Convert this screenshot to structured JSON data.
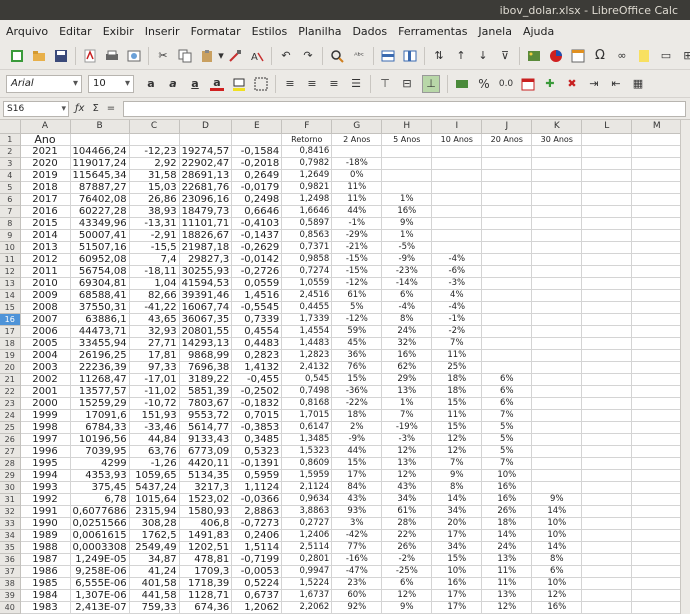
{
  "window": {
    "title": "ibov_dolar.xlsx - LibreOffice Calc"
  },
  "menu": [
    "Arquivo",
    "Editar",
    "Exibir",
    "Inserir",
    "Formatar",
    "Estilos",
    "Planilha",
    "Dados",
    "Ferramentas",
    "Janela",
    "Ajuda"
  ],
  "formatting": {
    "font_name": "Arial",
    "font_size": "10"
  },
  "formula_bar": {
    "cell_ref": "S16",
    "fx": "ƒx",
    "sum": "Σ",
    "equals": "=",
    "content": ""
  },
  "selected_row": 16,
  "columns": [
    "A",
    "B",
    "C",
    "D",
    "E",
    "F",
    "G",
    "H",
    "I",
    "J",
    "K",
    "L",
    "M"
  ],
  "rows": [
    [
      "Ano",
      "",
      "",
      "",
      "",
      "Retorno",
      "2 Anos",
      "5 Anos",
      "10 Anos",
      "20 Anos",
      "30 Anos",
      "",
      ""
    ],
    [
      "2021",
      "104466,24",
      "-12,23",
      "19274,57",
      "-0,1584",
      "0,8416",
      "",
      "",
      "",
      "",
      "",
      "",
      ""
    ],
    [
      "2020",
      "119017,24",
      "2,92",
      "22902,47",
      "-0,2018",
      "0,7982",
      "-18%",
      "",
      "",
      "",
      "",
      "",
      ""
    ],
    [
      "2019",
      "115645,34",
      "31,58",
      "28691,13",
      "0,2649",
      "1,2649",
      "0%",
      "",
      "",
      "",
      "",
      "",
      ""
    ],
    [
      "2018",
      "87887,27",
      "15,03",
      "22681,76",
      "-0,0179",
      "0,9821",
      "11%",
      "",
      "",
      "",
      "",
      "",
      ""
    ],
    [
      "2017",
      "76402,08",
      "26,86",
      "23096,16",
      "0,2498",
      "1,2498",
      "11%",
      "1%",
      "",
      "",
      "",
      "",
      ""
    ],
    [
      "2016",
      "60227,28",
      "38,93",
      "18479,73",
      "0,6646",
      "1,6646",
      "44%",
      "16%",
      "",
      "",
      "",
      "",
      ""
    ],
    [
      "2015",
      "43349,96",
      "-13,31",
      "11101,71",
      "-0,4103",
      "0,5897",
      "-1%",
      "9%",
      "",
      "",
      "",
      "",
      ""
    ],
    [
      "2014",
      "50007,41",
      "-2,91",
      "18826,67",
      "-0,1437",
      "0,8563",
      "-29%",
      "1%",
      "",
      "",
      "",
      "",
      ""
    ],
    [
      "2013",
      "51507,16",
      "-15,5",
      "21987,18",
      "-0,2629",
      "0,7371",
      "-21%",
      "-5%",
      "",
      "",
      "",
      "",
      ""
    ],
    [
      "2012",
      "60952,08",
      "7,4",
      "29827,3",
      "-0,0142",
      "0,9858",
      "-15%",
      "-9%",
      "-4%",
      "",
      "",
      "",
      ""
    ],
    [
      "2011",
      "56754,08",
      "-18,11",
      "30255,93",
      "-0,2726",
      "0,7274",
      "-15%",
      "-23%",
      "-6%",
      "",
      "",
      "",
      ""
    ],
    [
      "2010",
      "69304,81",
      "1,04",
      "41594,53",
      "0,0559",
      "1,0559",
      "-12%",
      "-14%",
      "-3%",
      "",
      "",
      "",
      ""
    ],
    [
      "2009",
      "68588,41",
      "82,66",
      "39391,46",
      "1,4516",
      "2,4516",
      "61%",
      "6%",
      "4%",
      "",
      "",
      "",
      ""
    ],
    [
      "2008",
      "37550,31",
      "-41,22",
      "16067,74",
      "-0,5545",
      "0,4455",
      "5%",
      "-4%",
      "-4%",
      "",
      "",
      "",
      ""
    ],
    [
      "2007",
      "63886,1",
      "43,65",
      "36067,35",
      "0,7339",
      "1,7339",
      "-12%",
      "8%",
      "-1%",
      "",
      "",
      "",
      ""
    ],
    [
      "2006",
      "44473,71",
      "32,93",
      "20801,55",
      "0,4554",
      "1,4554",
      "59%",
      "24%",
      "-2%",
      "",
      "",
      "",
      ""
    ],
    [
      "2005",
      "33455,94",
      "27,71",
      "14293,13",
      "0,4483",
      "1,4483",
      "45%",
      "32%",
      "7%",
      "",
      "",
      "",
      ""
    ],
    [
      "2004",
      "26196,25",
      "17,81",
      "9868,99",
      "0,2823",
      "1,2823",
      "36%",
      "16%",
      "11%",
      "",
      "",
      "",
      ""
    ],
    [
      "2003",
      "22236,39",
      "97,33",
      "7696,38",
      "1,4132",
      "2,4132",
      "76%",
      "62%",
      "25%",
      "",
      "",
      "",
      ""
    ],
    [
      "2002",
      "11268,47",
      "-17,01",
      "3189,22",
      "-0,455",
      "0,545",
      "15%",
      "29%",
      "18%",
      "6%",
      "",
      "",
      ""
    ],
    [
      "2001",
      "13577,57",
      "-11,02",
      "5851,39",
      "-0,2502",
      "0,7498",
      "-36%",
      "13%",
      "18%",
      "6%",
      "",
      "",
      ""
    ],
    [
      "2000",
      "15259,29",
      "-10,72",
      "7803,67",
      "-0,1832",
      "0,8168",
      "-22%",
      "1%",
      "15%",
      "6%",
      "",
      "",
      ""
    ],
    [
      "1999",
      "17091,6",
      "151,93",
      "9553,72",
      "0,7015",
      "1,7015",
      "18%",
      "7%",
      "11%",
      "7%",
      "",
      "",
      ""
    ],
    [
      "1998",
      "6784,33",
      "-33,46",
      "5614,77",
      "-0,3853",
      "0,6147",
      "2%",
      "-19%",
      "15%",
      "5%",
      "",
      "",
      ""
    ],
    [
      "1997",
      "10196,56",
      "44,84",
      "9133,43",
      "0,3485",
      "1,3485",
      "-9%",
      "-3%",
      "12%",
      "5%",
      "",
      "",
      ""
    ],
    [
      "1996",
      "7039,95",
      "63,76",
      "6773,09",
      "0,5323",
      "1,5323",
      "44%",
      "12%",
      "12%",
      "5%",
      "",
      "",
      ""
    ],
    [
      "1995",
      "4299",
      "-1,26",
      "4420,11",
      "-0,1391",
      "0,8609",
      "15%",
      "13%",
      "7%",
      "7%",
      "",
      "",
      ""
    ],
    [
      "1994",
      "4353,93",
      "1059,65",
      "5134,35",
      "0,5959",
      "1,5959",
      "17%",
      "12%",
      "9%",
      "10%",
      "",
      "",
      ""
    ],
    [
      "1993",
      "375,45",
      "5437,24",
      "3217,3",
      "1,1124",
      "2,1124",
      "84%",
      "43%",
      "8%",
      "16%",
      "",
      "",
      ""
    ],
    [
      "1992",
      "6,78",
      "1015,64",
      "1523,02",
      "-0,0366",
      "0,9634",
      "43%",
      "34%",
      "14%",
      "16%",
      "9%",
      "",
      ""
    ],
    [
      "1991",
      "0,6077686",
      "2315,94",
      "1580,93",
      "2,8863",
      "3,8863",
      "93%",
      "61%",
      "34%",
      "26%",
      "14%",
      "",
      ""
    ],
    [
      "1990",
      "0,0251566",
      "308,28",
      "406,8",
      "-0,7273",
      "0,2727",
      "3%",
      "28%",
      "20%",
      "18%",
      "10%",
      "",
      ""
    ],
    [
      "1989",
      "0,0061615",
      "1762,5",
      "1491,83",
      "0,2406",
      "1,2406",
      "-42%",
      "22%",
      "17%",
      "14%",
      "10%",
      "",
      ""
    ],
    [
      "1988",
      "0,0003308",
      "2549,49",
      "1202,51",
      "1,5114",
      "2,5114",
      "77%",
      "26%",
      "34%",
      "24%",
      "14%",
      "",
      ""
    ],
    [
      "1987",
      "1,249E-05",
      "34,87",
      "478,81",
      "-0,7199",
      "0,2801",
      "-16%",
      "-2%",
      "15%",
      "13%",
      "8%",
      "",
      ""
    ],
    [
      "1986",
      "9,258E-06",
      "41,24",
      "1709,3",
      "-0,0053",
      "0,9947",
      "-47%",
      "-25%",
      "10%",
      "11%",
      "6%",
      "",
      ""
    ],
    [
      "1985",
      "6,555E-06",
      "401,58",
      "1718,39",
      "0,5224",
      "1,5224",
      "23%",
      "6%",
      "16%",
      "11%",
      "10%",
      "",
      ""
    ],
    [
      "1984",
      "1,307E-06",
      "441,58",
      "1128,71",
      "0,6737",
      "1,6737",
      "60%",
      "12%",
      "17%",
      "13%",
      "12%",
      "",
      ""
    ],
    [
      "1983",
      "2,413E-07",
      "759,33",
      "674,36",
      "1,2062",
      "2,2062",
      "92%",
      "9%",
      "17%",
      "12%",
      "16%",
      "",
      ""
    ]
  ]
}
